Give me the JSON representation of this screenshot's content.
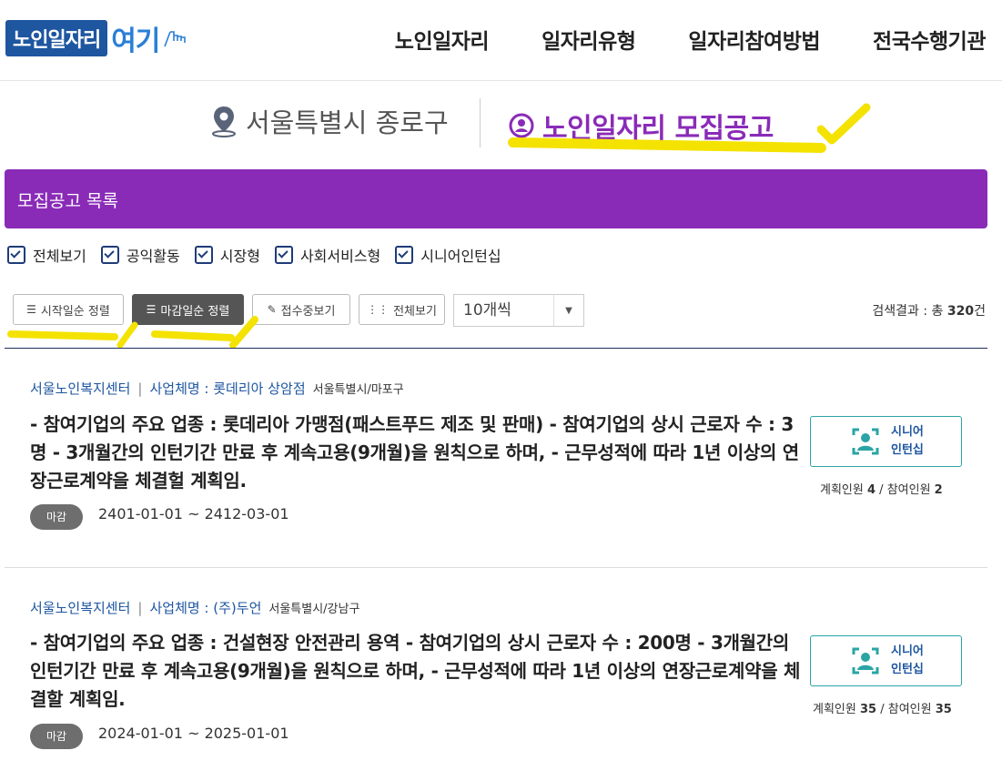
{
  "header": {
    "logo_main": "노인일자리",
    "logo_accent": "여기",
    "nav": [
      "노인일자리",
      "일자리유형",
      "일자리참여방법",
      "전국수행기관"
    ]
  },
  "location": "서울특별시 종로구",
  "page_title": "노인일자리 모집공고",
  "list_title": "모집공고 목록",
  "filters": [
    "전체보기",
    "공익활동",
    "시장형",
    "사회서비스형",
    "시니어인턴십"
  ],
  "toolbar": {
    "sort_start": "시작일순 정렬",
    "sort_end": "마감일순 정렬",
    "accepting": "접수중보기",
    "view_all": "전체보기",
    "per_page": "10개씩",
    "result_prefix": "검색결과 : 총 ",
    "result_count": "320",
    "result_suffix": "건"
  },
  "listings": [
    {
      "center": "서울노인복지센터",
      "sep": "|",
      "company": "사업체명 : 롯데리아 상암점",
      "region": "서울특별시/마포구",
      "description": "- 참여기업의 주요 업종 : 롯데리아 가맹점(패스트푸드 제조 및 판매) - 참여기업의 상시 근로자 수 : 3명 - 3개월간의 인턴기간 만료 후 계속고용(9개월)을 원칙으로 하며, - 근무성적에 따라 1년 이상의 연장근로계약을 체결헐 계획임.",
      "status": "마감",
      "period": "2401-01-01 ~ 2412-03-01",
      "type_line1": "시니어",
      "type_line2": "인턴십",
      "planned_label": "계획인원 ",
      "planned": "4",
      "slash": " / ",
      "joined_label": "참여인원 ",
      "joined": "2"
    },
    {
      "center": "서울노인복지센터",
      "sep": "|",
      "company": "사업체명 : (주)두언",
      "region": "서울특별시/강남구",
      "description": "- 참여기업의 주요 업종 : 건설현장 안전관리 용역 - 참여기업의 상시 근로자 수 : 200명 - 3개월간의 인턴기간 만료 후 계속고용(9개월)을 원칙으로 하며, - 근무성적에 따라 1년 이상의 연장근로계약을 체결할 계획임.",
      "status": "마감",
      "period": "2024-01-01 ~ 2025-01-01",
      "type_line1": "시니어",
      "type_line2": "인턴십",
      "planned_label": "계획인원 ",
      "planned": "35",
      "slash": " / ",
      "joined_label": "참여인원 ",
      "joined": "35"
    }
  ]
}
